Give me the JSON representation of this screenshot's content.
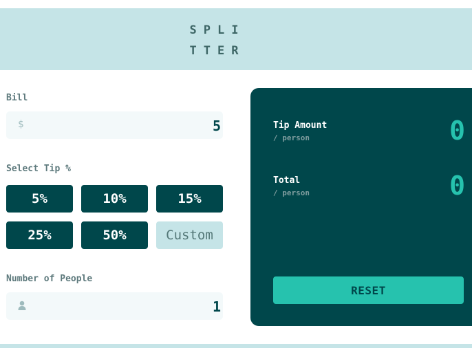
{
  "app": {
    "logo_line1": "SPLI",
    "logo_line2": "TTER"
  },
  "bill": {
    "label": "Bill",
    "currency_symbol": "$",
    "value": "5"
  },
  "tip": {
    "label": "Select Tip %",
    "options": [
      "5%",
      "10%",
      "15%",
      "25%",
      "50%"
    ],
    "custom_placeholder": "Custom"
  },
  "people": {
    "label": "Number of People",
    "icon": "person-icon",
    "value": "1"
  },
  "results": {
    "tip_amount_label": "Tip Amount",
    "tip_amount_sub": "/ person",
    "tip_amount_value": "0",
    "total_label": "Total",
    "total_sub": "/ person",
    "total_value": "0",
    "reset_label": "RESET"
  },
  "colors": {
    "dark_cyan": "#00474b",
    "strong_cyan": "#26c2ae",
    "light_cyan": "#c5e4e7",
    "input_bg": "#f3f9fa"
  }
}
